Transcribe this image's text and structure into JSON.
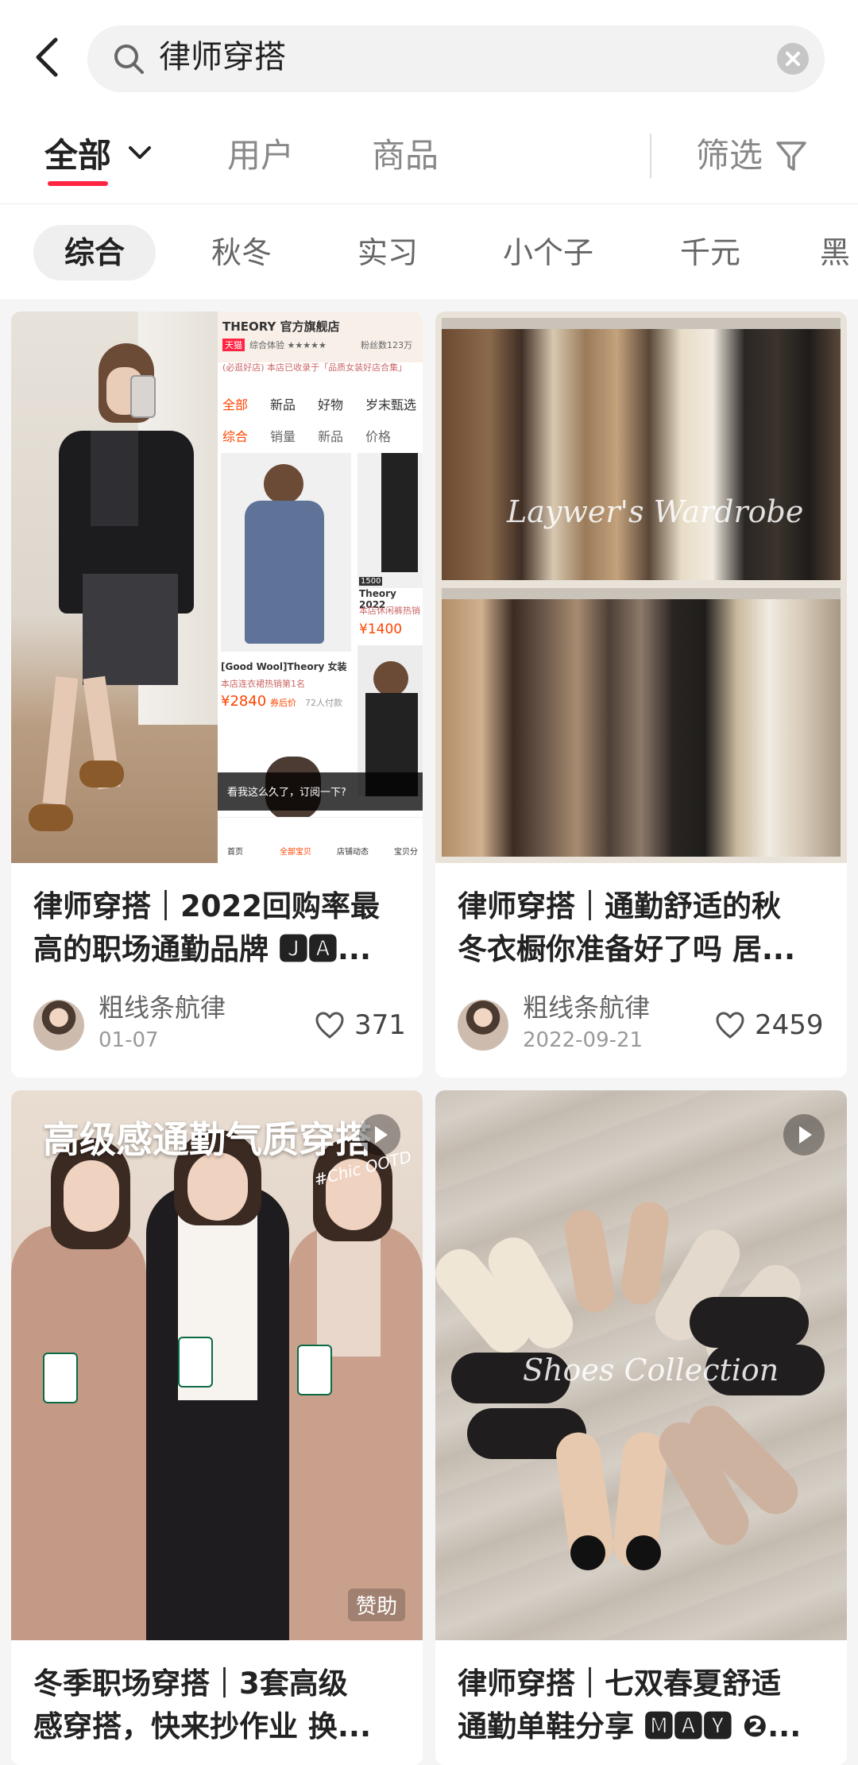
{
  "search": {
    "query": "律师穿搭"
  },
  "tabs": {
    "all": "全部",
    "users": "用户",
    "goods": "商品",
    "filter": "筛选"
  },
  "subtabs": [
    "综合",
    "秋冬",
    "实习",
    "小个子",
    "千元",
    "黑"
  ],
  "cards": [
    {
      "title_line1": "律师穿搭｜2022回购率最",
      "title_line2": "高的职场通勤品牌 🅹🅰...",
      "author": "粗线条航律",
      "date": "01-07",
      "likes": "371",
      "store": {
        "name": "THEORY 官方旗舰店",
        "tag": "天猫",
        "rating_text": "综合体验 ★★★★★",
        "fans": "粉丝数123万",
        "banner": "(必逛好店) 本店已收录于「品质女装好店合集」",
        "nav": [
          "全部",
          "新品",
          "好物",
          "岁末甄选"
        ],
        "sort": [
          "综合",
          "销量",
          "新品",
          "价格"
        ],
        "product_name": "[Good Wool]Theory 女装",
        "product_rank": "本店连衣裙热销第1名",
        "price": "¥2840",
        "price_tag": "券后价",
        "buyers": "72人付款",
        "side_price_top": "1500",
        "side_name": "Theory 2022",
        "side_rank": "本店休闲裤热销",
        "side_price": "¥1400",
        "tooltip": "看我这么久了，订阅一下?",
        "bottom_nav": [
          "首页",
          "全部宝贝",
          "店铺动态",
          "宝贝分"
        ]
      }
    },
    {
      "title_line1": "律师穿搭｜通勤舒适的秋",
      "title_line2": "冬衣橱你准备好了吗 居...",
      "author": "粗线条航律",
      "date": "2022-09-21",
      "likes": "2459",
      "watermark": "Laywer's Wardrobe"
    },
    {
      "title_line1": "冬季职场穿搭｜3套高级",
      "title_line2": "感穿搭，快来抄作业 换...",
      "overlay": "高级感通勤气质穿搭",
      "badge": "#Chic OOTD",
      "sponsor": "赞助"
    },
    {
      "title_line1": "律师穿搭｜七双春夏舒适",
      "title_line2": "通勤单鞋分享 🅼🅰🆈 ❷...",
      "watermark": "Shoes Collection"
    }
  ],
  "icons": [
    "back-icon",
    "search-icon",
    "clear-icon",
    "chevron-down-icon",
    "filter-icon",
    "heart-icon",
    "play-icon"
  ],
  "colors": {
    "accent": "#ff2442"
  }
}
